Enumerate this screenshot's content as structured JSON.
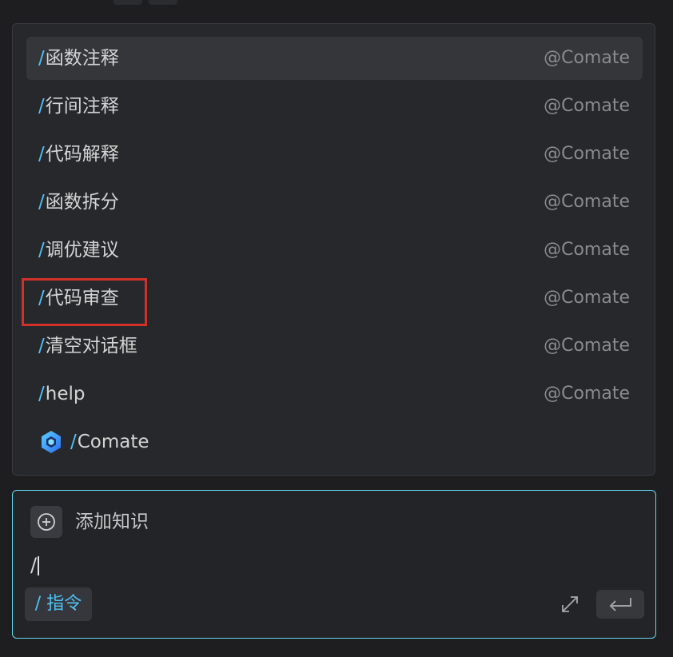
{
  "menu": {
    "items": [
      {
        "command": "函数注释",
        "source": "@Comate",
        "active": true
      },
      {
        "command": "行间注释",
        "source": "@Comate"
      },
      {
        "command": "代码解释",
        "source": "@Comate"
      },
      {
        "command": "函数拆分",
        "source": "@Comate"
      },
      {
        "command": "调优建议",
        "source": "@Comate"
      },
      {
        "command": "代码审查",
        "source": "@Comate"
      },
      {
        "command": "清空对话框",
        "source": "@Comate"
      },
      {
        "command": "help",
        "source": "@Comate"
      }
    ],
    "comate_item": {
      "command": "Comate",
      "icon": "comate-logo-icon"
    },
    "slash": "/"
  },
  "input_panel": {
    "add_knowledge_label": "添加知识",
    "query_value": "/",
    "command_chip": "/ 指令"
  },
  "icons": {
    "add": "plus-circle-icon",
    "expand": "expand-arrows-icon",
    "send": "enter-return-icon"
  },
  "colors": {
    "accent": "#4fc3f7",
    "highlight": "#d2302a",
    "panel_border": "#63d6ee"
  }
}
